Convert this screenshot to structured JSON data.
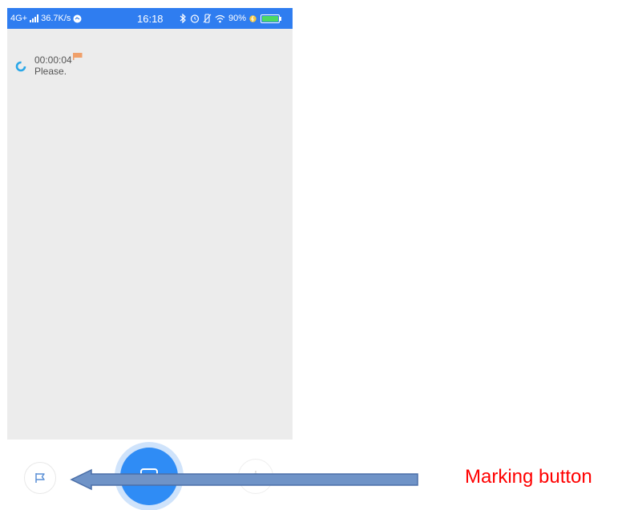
{
  "status_bar": {
    "network": "4G+",
    "speed": "36.7K/s",
    "time": "16:18",
    "battery": "90%",
    "icons": [
      "signal-icon",
      "sync-icon",
      "bluetooth-icon",
      "alarm-icon",
      "vibrate-icon",
      "wifi-icon",
      "battery-icon"
    ]
  },
  "recording": {
    "time": "00:00:04",
    "text": "Please."
  },
  "bottom_bar": {
    "icons": [
      "flag-icon",
      "record-icon",
      "settings-icon"
    ]
  },
  "annotation": {
    "label": "Marking button"
  },
  "colors": {
    "accent": "#2f8cf5",
    "status_bar": "#2f7df0",
    "annotation": "#ff0000",
    "flag": "#f0a06a",
    "arrow": "#6f93c7"
  }
}
